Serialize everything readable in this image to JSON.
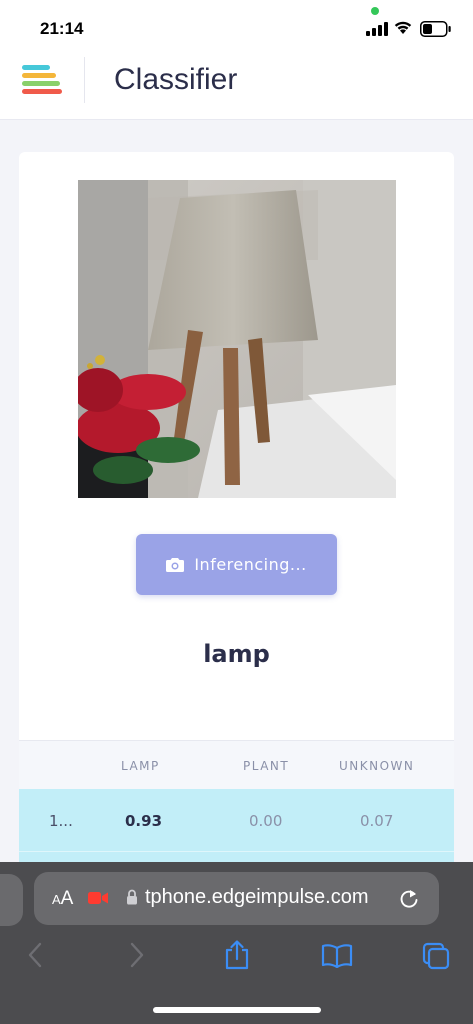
{
  "status_bar": {
    "time": "21:14"
  },
  "header": {
    "title": "Classifier"
  },
  "classifier": {
    "button_label": "Inferencing...",
    "result": "lamp",
    "table": {
      "columns": [
        "",
        "LAMP",
        "PLANT",
        "UNKNOWN"
      ],
      "rows": [
        {
          "id": "1...",
          "lamp": "0.93",
          "plant": "0.00",
          "unknown": "0.07"
        }
      ]
    }
  },
  "browser": {
    "aa_small": "A",
    "aa_large": "A",
    "url": "tphone.edgeimpulse.com"
  },
  "icons": {
    "logo": "edge-impulse-logo",
    "camera": "camera-icon",
    "record": "recording-camera-icon",
    "lock": "lock-icon",
    "reload": "reload-icon",
    "back": "chevron-left-icon",
    "forward": "chevron-right-icon",
    "share": "share-icon",
    "bookmarks": "book-icon",
    "tabs": "tabs-icon"
  },
  "colors": {
    "accent_button": "#9aa3e7",
    "highlight_row": "#c2eef8",
    "title": "#2b2e4a"
  }
}
